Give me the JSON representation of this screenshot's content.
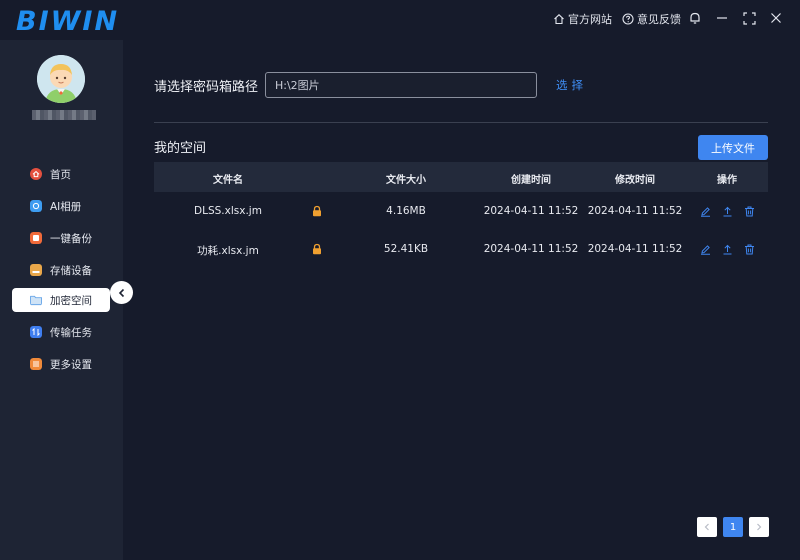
{
  "app": {
    "logo": "BIWIN"
  },
  "titlebar": {
    "website_label": "官方网站",
    "feedback_label": "意见反馈",
    "icons": [
      "home-icon",
      "help-icon",
      "bell-icon",
      "minimize-icon",
      "maximize-icon",
      "close-icon"
    ]
  },
  "sidebar": {
    "items": [
      {
        "label": "首页",
        "icon": "home-icon",
        "color": "#e4503f",
        "active": false
      },
      {
        "label": "AI相册",
        "icon": "photo-icon",
        "color": "#3d9cf0",
        "active": false
      },
      {
        "label": "一键备份",
        "icon": "backup-icon",
        "color": "#f06a3a",
        "active": false
      },
      {
        "label": "存储设备",
        "icon": "storage-icon",
        "color": "#e9a74a",
        "active": false
      },
      {
        "label": "加密空间",
        "icon": "encrypted-folder-icon",
        "color": "#6aa7e8",
        "active": true
      },
      {
        "label": "传输任务",
        "icon": "transfer-icon",
        "color": "#3f7ef0",
        "active": false
      },
      {
        "label": "更多设置",
        "icon": "settings-icon",
        "color": "#f08a3a",
        "active": false
      }
    ]
  },
  "main": {
    "path_label": "请选择密码箱路径",
    "path_value": "H:\\2图片",
    "select_label": "选择",
    "space_title": "我的空间",
    "upload_label": "上传文件",
    "table": {
      "headers": [
        "文件名",
        "文件大小",
        "创建时间",
        "修改时间",
        "操作"
      ],
      "rows": [
        {
          "name": "DLSS.xlsx.jm",
          "size": "4.16MB",
          "created": "2024-04-11 11:52",
          "modified": "2024-04-11 11:52"
        },
        {
          "name": "功耗.xlsx.jm",
          "size": "52.41KB",
          "created": "2024-04-11 11:52",
          "modified": "2024-04-11 11:52"
        }
      ]
    },
    "pagination": {
      "current_page": "1"
    }
  },
  "colors": {
    "accent": "#3f86f0",
    "lock": "#f0a030",
    "background": "#161b2b",
    "sidebar": "#1e2434"
  }
}
